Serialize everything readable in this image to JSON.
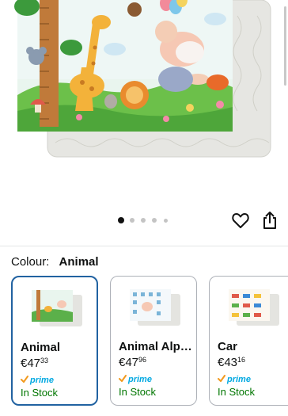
{
  "product": {
    "image_alt": "Baby play mat with jungle animals and height chart",
    "image_count": 5,
    "active_image": 0
  },
  "variation": {
    "label": "Colour:",
    "selected": "Animal"
  },
  "options": [
    {
      "name": "Animal",
      "currency": "€",
      "price_whole": "47",
      "price_fraction": "33",
      "prime": "prime",
      "availability": "In Stock",
      "selected": true
    },
    {
      "name": "Animal Alp…",
      "currency": "€",
      "price_whole": "47",
      "price_fraction": "96",
      "prime": "prime",
      "availability": "In Stock",
      "selected": false
    },
    {
      "name": "Car",
      "currency": "€",
      "price_whole": "43",
      "price_fraction": "16",
      "prime": "prime",
      "availability": "In Stock",
      "selected": false
    }
  ],
  "colors": {
    "accent": "#2162a1",
    "prime": "#00a8e1",
    "instock": "#007600"
  }
}
